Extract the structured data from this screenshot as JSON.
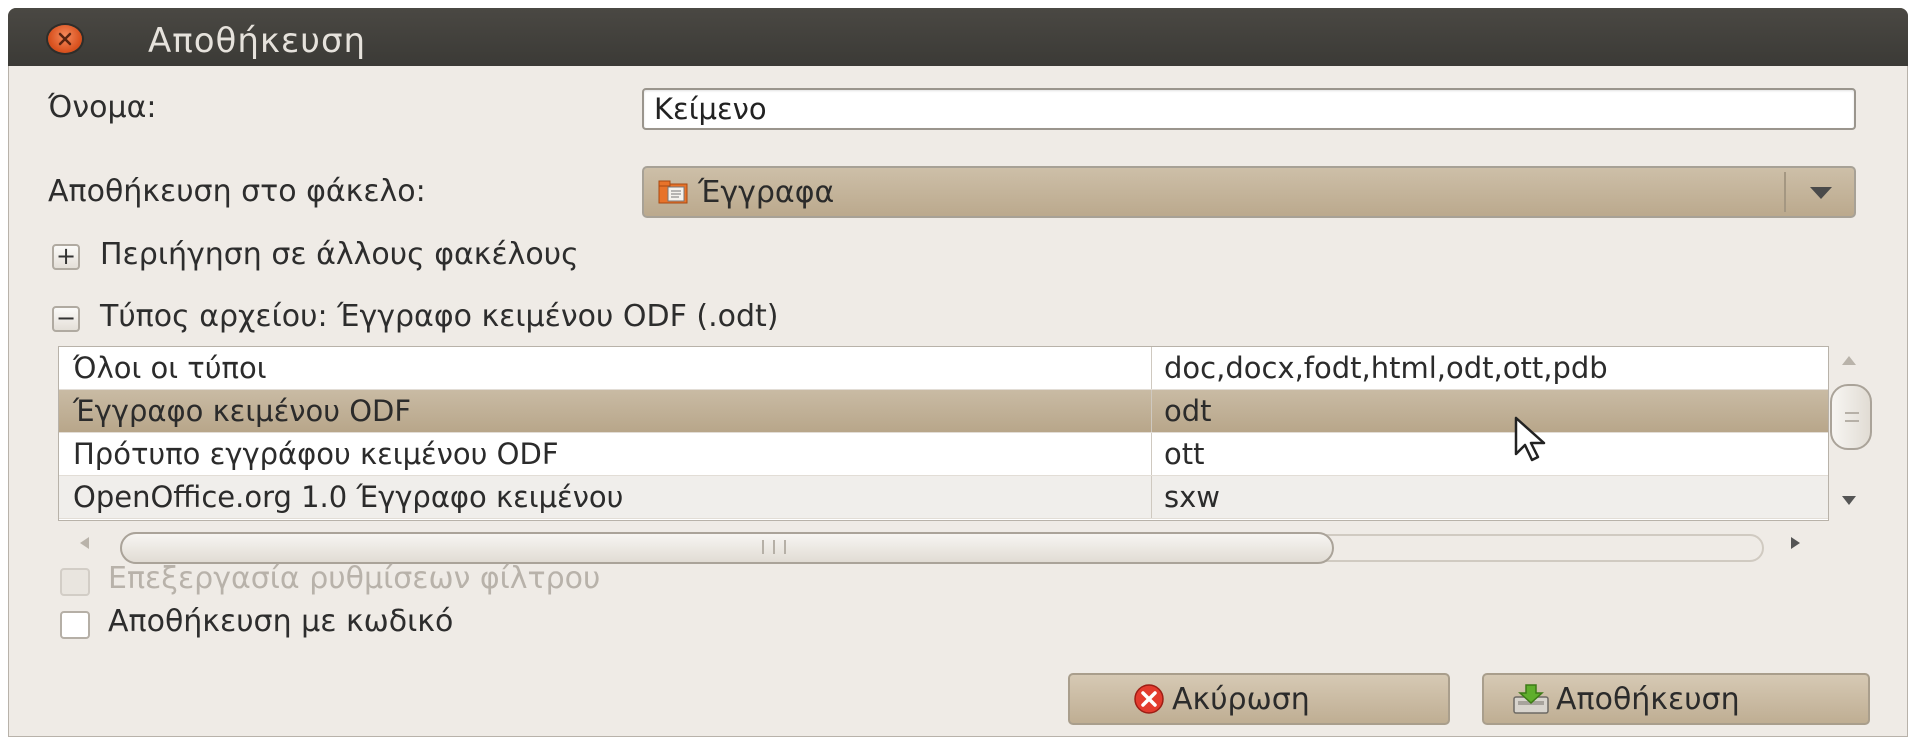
{
  "window": {
    "title": "Αποθήκευση"
  },
  "name_field": {
    "label": "Όνομα:",
    "value": "Κείμενο"
  },
  "folder": {
    "label": "Αποθήκευση στο φάκελο:",
    "selected": "Έγγραφα"
  },
  "browse": {
    "label": "Περιήγηση σε άλλους φακέλους",
    "expander": "+"
  },
  "filetype": {
    "label": "Τύπος αρχείου: Έγγραφο κειμένου ODF (.odt)",
    "expander": "−"
  },
  "filetypes": [
    {
      "name": "Όλοι οι τύποι",
      "ext": "doc,docx,fodt,html,odt,ott,pdb"
    },
    {
      "name": "Έγγραφο κειμένου ODF",
      "ext": "odt",
      "selected": true
    },
    {
      "name": "Πρότυπο εγγράφου κειμένου ODF",
      "ext": "ott"
    },
    {
      "name": "OpenOffice.org 1.0 Έγγραφο κειμένου",
      "ext": "sxw"
    }
  ],
  "options": {
    "filter_settings": {
      "label": "Επεξεργασία ρυθμίσεων φίλτρου",
      "checked": false,
      "disabled": true
    },
    "password": {
      "label": "Αποθήκευση με κωδικό",
      "checked": false
    }
  },
  "buttons": {
    "cancel": "Ακύρωση",
    "save": "Αποθήκευση"
  },
  "colors": {
    "titlebar": "#3c3b37",
    "selection": "#bfae93",
    "dialog_bg": "#efebe6",
    "close": "#e05a24"
  },
  "icons": [
    "close-icon",
    "folder-icon",
    "cancel-icon",
    "save-icon",
    "mouse-cursor-icon"
  ]
}
